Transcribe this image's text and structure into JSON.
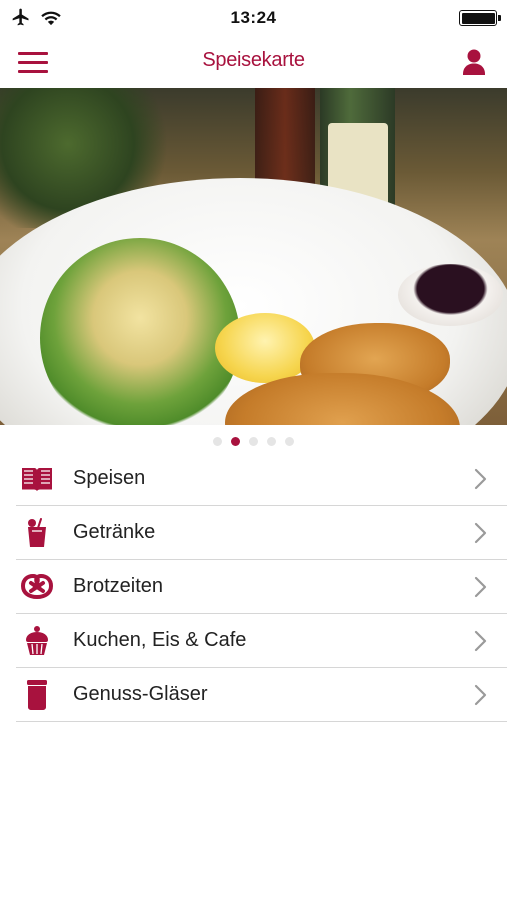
{
  "status_bar": {
    "time": "13:24",
    "icons": [
      "airplane-icon",
      "wifi-icon",
      "battery-icon"
    ]
  },
  "nav": {
    "title": "Speisekarte",
    "menu_icon": "hamburger-menu-icon",
    "profile_icon": "user-icon"
  },
  "carousel": {
    "dot_count": 5,
    "active_dot": 1
  },
  "colors": {
    "accent": "#a8123e",
    "separator": "#d6d6d6",
    "chevron": "#9a9a9a"
  },
  "menu": {
    "items": [
      {
        "label": "Speisen",
        "icon": "book-icon"
      },
      {
        "label": "Getränke",
        "icon": "cocktail-icon"
      },
      {
        "label": "Brotzeiten",
        "icon": "pretzel-icon"
      },
      {
        "label": "Kuchen, Eis & Cafe",
        "icon": "cupcake-icon"
      },
      {
        "label": "Genuss-Gläser",
        "icon": "jar-icon"
      }
    ]
  }
}
